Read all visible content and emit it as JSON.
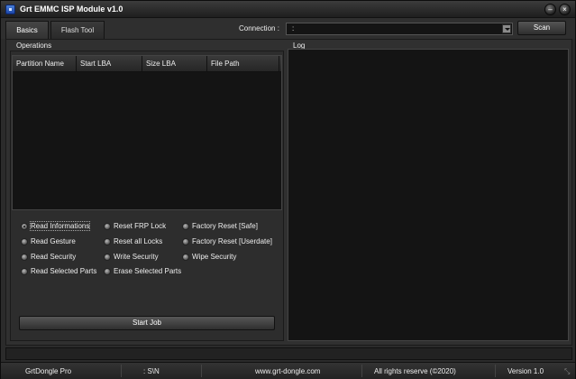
{
  "window": {
    "title": "Grt EMMC ISP Module v1.0"
  },
  "tabs": [
    "Basics",
    "Flash Tool"
  ],
  "connection": {
    "label": "Connection :",
    "value": ":"
  },
  "scan_label": "Scan",
  "operations": {
    "label": "Operations",
    "columns": [
      "Partition Name",
      "Start LBA",
      "Size LBA",
      "File Path"
    ],
    "rows": [],
    "options": [
      [
        "Read Informations",
        "Reset FRP Lock",
        "Factory Reset [Safe]"
      ],
      [
        "Read Gesture",
        "Reset all Locks",
        "Factory Reset [Userdate]"
      ],
      [
        "Read Security",
        "Write Security",
        "Wipe Security"
      ],
      [
        "Read Selected Parts",
        "Erase Selected Parts"
      ]
    ],
    "selected_option": "Read Informations",
    "start_label": "Start Job"
  },
  "log": {
    "label": "Log"
  },
  "status": {
    "app": "GrtDongle Pro",
    "port": ": S\\N",
    "site": "www.grt-dongle.com",
    "rights": "All rights reserve  (©2020)",
    "version": "Version 1.0"
  },
  "colors": {
    "background": "#2b2b2b",
    "panel": "#141414",
    "text": "#e8e8e8"
  }
}
